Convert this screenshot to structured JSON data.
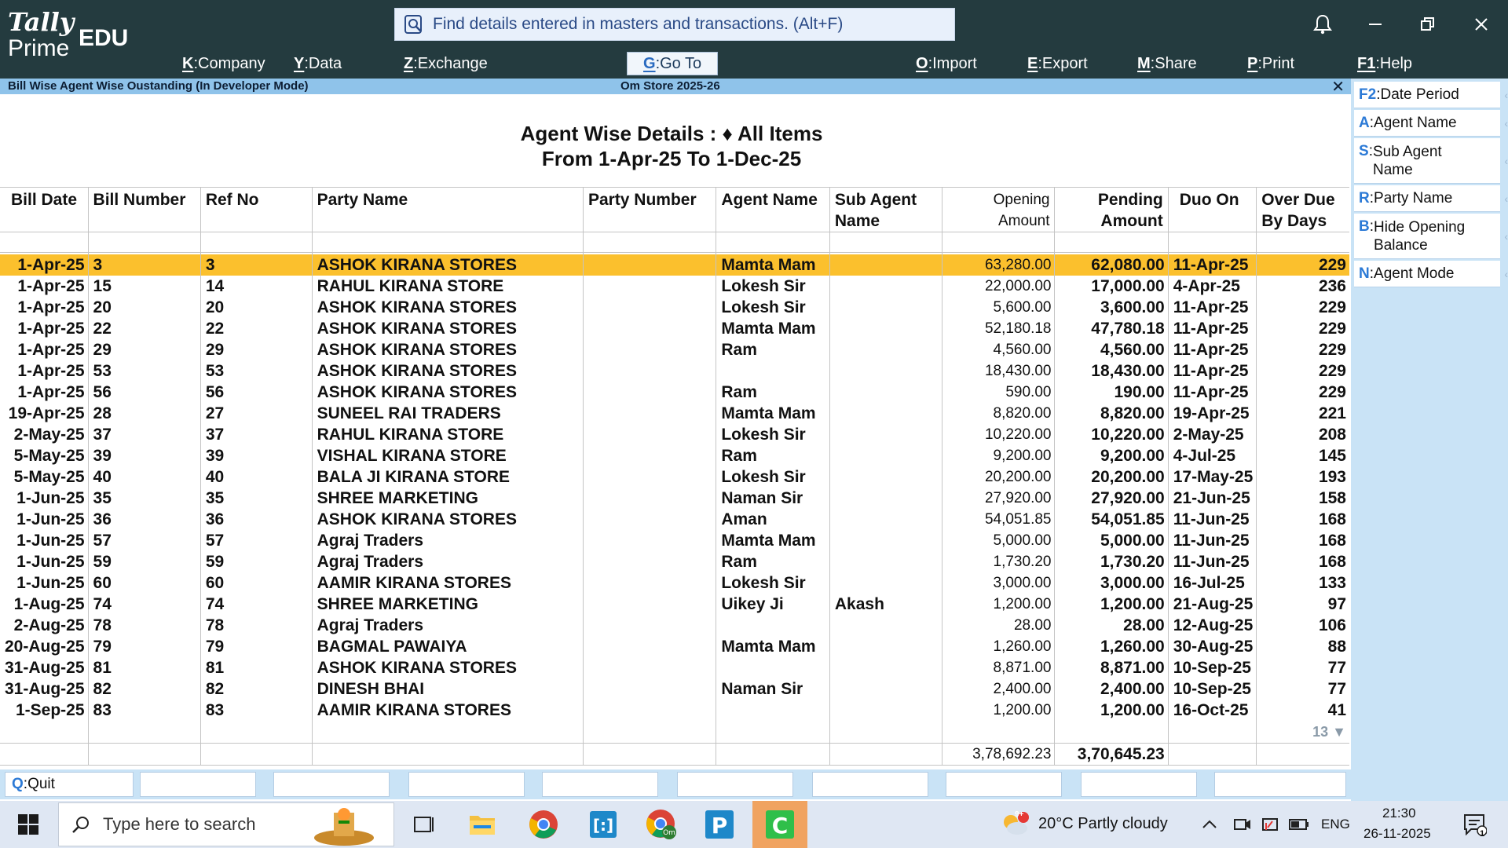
{
  "app": {
    "logo_top": "Tally",
    "logo_bottom": "Prime",
    "edition": "EDU",
    "search_placeholder": "Find details entered in masters and transactions. (Alt+F)"
  },
  "menu": [
    {
      "key": "K",
      "label": "Company"
    },
    {
      "key": "Y",
      "label": "Data"
    },
    {
      "key": "Z",
      "label": "Exchange"
    },
    {
      "key": "G",
      "label": "Go To"
    },
    {
      "key": "O",
      "label": "Import"
    },
    {
      "key": "E",
      "label": "Export"
    },
    {
      "key": "M",
      "label": "Share"
    },
    {
      "key": "P",
      "label": "Print"
    },
    {
      "key": "F1",
      "label": "Help"
    }
  ],
  "strip": {
    "report_name": "Bill Wise Agent Wise Oustanding  (In Developer Mode)",
    "company": "Om  Store 2025-26",
    "close": "✕"
  },
  "report": {
    "title_line1": "Agent Wise Details  : ♦ All Items",
    "title_line2": "From 1-Apr-25 To 1-Dec-25",
    "columns": {
      "bill_date": "Bill Date",
      "bill_number": "Bill Number",
      "ref_no": "Ref No",
      "party_name": "Party Name",
      "party_number": "Party Number",
      "agent_name": "Agent Name",
      "sub_agent_1": "Sub Agent",
      "sub_agent_2": "Name",
      "opening_1": "Opening",
      "opening_2": "Amount",
      "pending_1": "Pending",
      "pending_2": "Amount",
      "due_on": "Duo On",
      "overdue_1": "Over Due",
      "overdue_2": "By Days"
    },
    "rows": [
      [
        "1-Apr-25",
        "3",
        "3",
        "ASHOK KIRANA STORES",
        "",
        "Mamta Mam",
        "",
        "63,280.00",
        "62,080.00",
        "11-Apr-25",
        "229"
      ],
      [
        "1-Apr-25",
        "15",
        "14",
        "RAHUL KIRANA STORE",
        "",
        "Lokesh Sir",
        "",
        "22,000.00",
        "17,000.00",
        "4-Apr-25",
        "236"
      ],
      [
        "1-Apr-25",
        "20",
        "20",
        "ASHOK KIRANA STORES",
        "",
        "Lokesh Sir",
        "",
        "5,600.00",
        "3,600.00",
        "11-Apr-25",
        "229"
      ],
      [
        "1-Apr-25",
        "22",
        "22",
        "ASHOK KIRANA STORES",
        "",
        "Mamta Mam",
        "",
        "52,180.18",
        "47,780.18",
        "11-Apr-25",
        "229"
      ],
      [
        "1-Apr-25",
        "29",
        "29",
        "ASHOK KIRANA STORES",
        "",
        "Ram",
        "",
        "4,560.00",
        "4,560.00",
        "11-Apr-25",
        "229"
      ],
      [
        "1-Apr-25",
        "53",
        "53",
        "ASHOK KIRANA STORES",
        "",
        "",
        "",
        "18,430.00",
        "18,430.00",
        "11-Apr-25",
        "229"
      ],
      [
        "1-Apr-25",
        "56",
        "56",
        "ASHOK KIRANA STORES",
        "",
        "Ram",
        "",
        "590.00",
        "190.00",
        "11-Apr-25",
        "229"
      ],
      [
        "19-Apr-25",
        "28",
        "27",
        "SUNEEL RAI TRADERS",
        "",
        "Mamta Mam",
        "",
        "8,820.00",
        "8,820.00",
        "19-Apr-25",
        "221"
      ],
      [
        "2-May-25",
        "37",
        "37",
        "RAHUL KIRANA STORE",
        "",
        "Lokesh Sir",
        "",
        "10,220.00",
        "10,220.00",
        "2-May-25",
        "208"
      ],
      [
        "5-May-25",
        "39",
        "39",
        "VISHAL KIRANA STORE",
        "",
        "Ram",
        "",
        "9,200.00",
        "9,200.00",
        "4-Jul-25",
        "145"
      ],
      [
        "5-May-25",
        "40",
        "40",
        "BALA JI KIRANA STORE",
        "",
        "Lokesh Sir",
        "",
        "20,200.00",
        "20,200.00",
        "17-May-25",
        "193"
      ],
      [
        "1-Jun-25",
        "35",
        "35",
        "SHREE MARKETING",
        "",
        "Naman Sir",
        "",
        "27,920.00",
        "27,920.00",
        "21-Jun-25",
        "158"
      ],
      [
        "1-Jun-25",
        "36",
        "36",
        "ASHOK KIRANA STORES",
        "",
        "Aman",
        "",
        "54,051.85",
        "54,051.85",
        "11-Jun-25",
        "168"
      ],
      [
        "1-Jun-25",
        "57",
        "57",
        "Agraj Traders",
        "",
        "Mamta Mam",
        "",
        "5,000.00",
        "5,000.00",
        "11-Jun-25",
        "168"
      ],
      [
        "1-Jun-25",
        "59",
        "59",
        "Agraj Traders",
        "",
        "Ram",
        "",
        "1,730.20",
        "1,730.20",
        "11-Jun-25",
        "168"
      ],
      [
        "1-Jun-25",
        "60",
        "60",
        "AAMIR KIRANA STORES",
        "",
        "Lokesh Sir",
        "",
        "3,000.00",
        "3,000.00",
        "16-Jul-25",
        "133"
      ],
      [
        "1-Aug-25",
        "74",
        "74",
        "SHREE MARKETING",
        "",
        "Uikey Ji",
        "Akash",
        "1,200.00",
        "1,200.00",
        "21-Aug-25",
        "97"
      ],
      [
        "2-Aug-25",
        "78",
        "78",
        "Agraj Traders",
        "",
        "",
        "",
        "28.00",
        "28.00",
        "12-Aug-25",
        "106"
      ],
      [
        "20-Aug-25",
        "79",
        "79",
        "BAGMAL PAWAIYA",
        "",
        "Mamta Mam",
        "",
        "1,260.00",
        "1,260.00",
        "30-Aug-25",
        "88"
      ],
      [
        "31-Aug-25",
        "81",
        "81",
        "ASHOK KIRANA STORES",
        "",
        "",
        "",
        "8,871.00",
        "8,871.00",
        "10-Sep-25",
        "77"
      ],
      [
        "31-Aug-25",
        "82",
        "82",
        "DINESH BHAI",
        "",
        "Naman Sir",
        "",
        "2,400.00",
        "2,400.00",
        "10-Sep-25",
        "77"
      ],
      [
        "1-Sep-25",
        "83",
        "83",
        "AAMIR KIRANA STORES",
        "",
        "",
        "",
        "1,200.00",
        "1,200.00",
        "16-Oct-25",
        "41"
      ]
    ],
    "more_count": "13 ▼",
    "total_opening": "3,78,692.23",
    "total_pending": "3,70,645.23"
  },
  "right_panel": [
    {
      "key": "F2",
      "label": "Date Period"
    },
    {
      "key": "A",
      "label": "Agent Name"
    },
    {
      "key": "S",
      "label": "Sub Agent Name"
    },
    {
      "key": "R",
      "label": "Party Name"
    },
    {
      "key": "B",
      "label": "Hide Opening Balance"
    },
    {
      "key": "N",
      "label": "Agent Mode"
    }
  ],
  "bottom_bar": {
    "quit_key": "Q",
    "quit_label": "Quit"
  },
  "taskbar": {
    "search_placeholder": "Type here to search",
    "weather": "20°C  Partly cloudy",
    "weather_badge": "9+",
    "lang": "ENG",
    "time": "21:30",
    "date": "26-11-2025",
    "notif_count": "1"
  },
  "colors": {
    "topbar": "#243b3f",
    "selected_row": "#fbc02d",
    "strip": "#8fc3ea",
    "side_panel": "#c9e3f6",
    "accent_key": "#2c7ad6"
  }
}
